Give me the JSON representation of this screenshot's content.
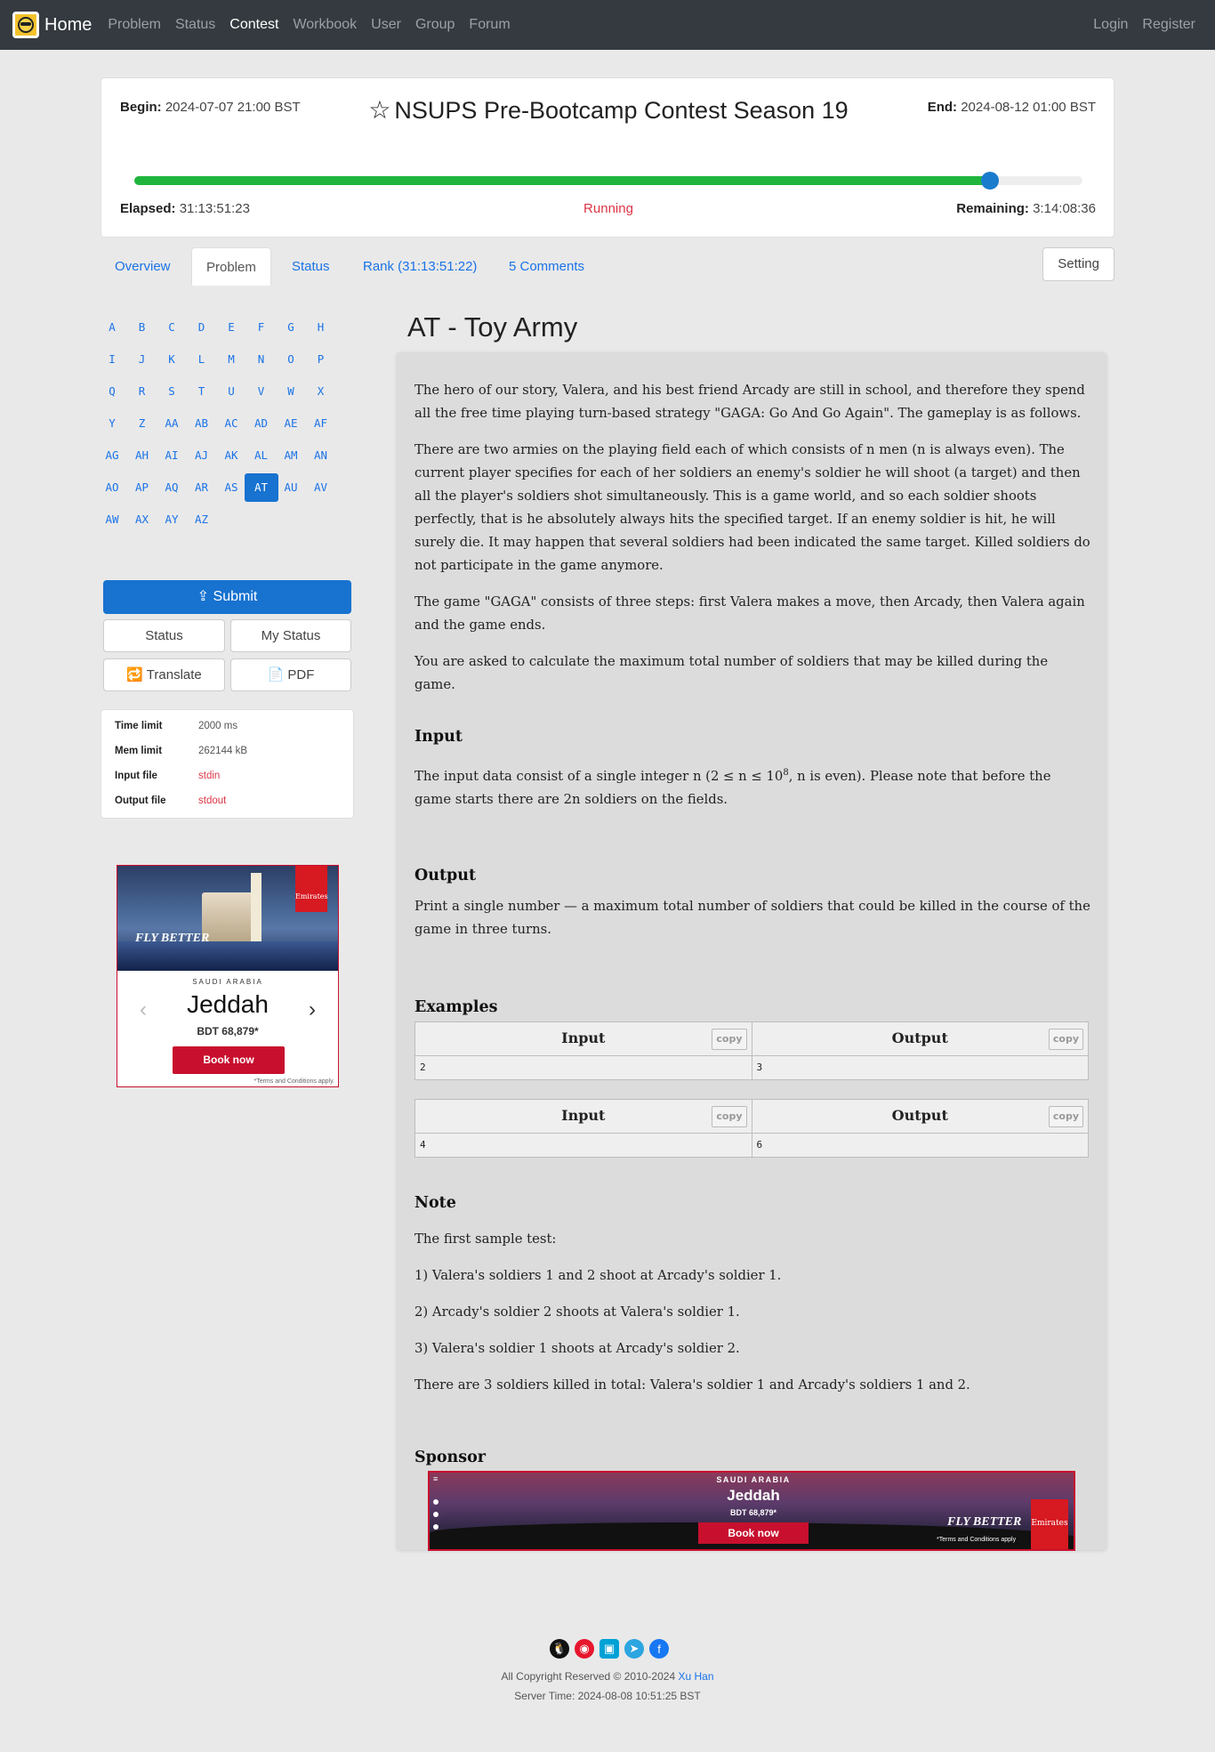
{
  "nav": {
    "brand": "Home",
    "items": [
      "Problem",
      "Status",
      "Contest",
      "Workbook",
      "User",
      "Group",
      "Forum"
    ],
    "active": "Contest",
    "login": "Login",
    "register": "Register"
  },
  "contest": {
    "begin_label": "Begin:",
    "begin": "2024-07-07 21:00 BST",
    "end_label": "End:",
    "end": "2024-08-12 01:00 BST",
    "title": "NSUPS Pre-Bootcamp Contest Season 19",
    "progress": 0.902,
    "elapsed_label": "Elapsed:",
    "elapsed": "31:13:51:23",
    "status": "Running",
    "remaining_label": "Remaining:",
    "remaining": "3:14:08:36"
  },
  "tabs": {
    "overview": "Overview",
    "problem": "Problem",
    "status": "Status",
    "rank": "Rank (31:13:51:22)",
    "comments": "5 Comments",
    "setting": "Setting"
  },
  "letters": [
    "A",
    "B",
    "C",
    "D",
    "E",
    "F",
    "G",
    "H",
    "I",
    "J",
    "K",
    "L",
    "M",
    "N",
    "O",
    "P",
    "Q",
    "R",
    "S",
    "T",
    "U",
    "V",
    "W",
    "X",
    "Y",
    "Z",
    "AA",
    "AB",
    "AC",
    "AD",
    "AE",
    "AF",
    "AG",
    "AH",
    "AI",
    "AJ",
    "AK",
    "AL",
    "AM",
    "AN",
    "AO",
    "AP",
    "AQ",
    "AR",
    "AS",
    "AT",
    "AU",
    "AV",
    "AW",
    "AX",
    "AY",
    "AZ"
  ],
  "active_letter": "AT",
  "actions": {
    "submit": "Submit",
    "status": "Status",
    "my_status": "My Status",
    "translate": "Translate",
    "pdf": "PDF"
  },
  "limits": {
    "time_label": "Time limit",
    "time": "2000 ms",
    "mem_label": "Mem limit",
    "mem": "262144 kB",
    "input_label": "Input file",
    "input": "stdin",
    "output_label": "Output file",
    "output": "stdout"
  },
  "ad": {
    "brand": "Emirates",
    "tagline": "FLY BETTER",
    "country": "SAUDI ARABIA",
    "city": "Jeddah",
    "price": "BDT 68,879*",
    "book": "Book now",
    "terms": "*Terms and Conditions apply."
  },
  "problem": {
    "title": "AT - Toy Army",
    "statement": [
      "The hero of our story, Valera, and his best friend Arcady are still in school, and therefore they spend all the free time playing turn-based strategy \"GAGA: Go And Go Again\". The gameplay is as follows.",
      "There are two armies on the playing field each of which consists of n men (n is always even). The current player specifies for each of her soldiers an enemy's soldier he will shoot (a target) and then all the player's soldiers shot simultaneously. This is a game world, and so each soldier shoots perfectly, that is he absolutely always hits the specified target. If an enemy soldier is hit, he will surely die. It may happen that several soldiers had been indicated the same target. Killed soldiers do not participate in the game anymore.",
      "The game \"GAGA\" consists of three steps: first Valera makes a move, then Arcady, then Valera again and the game ends.",
      "You are asked to calculate the maximum total number of soldiers that may be killed during the game."
    ],
    "input_title": "Input",
    "input_text_1": "The input data consist of a single integer n (2 ≤ n ≤ 10",
    "input_exp": "8",
    "input_text_2": ", n is even). Please note that before the game starts there are 2n soldiers on the fields.",
    "output_title": "Output",
    "output_text": "Print a single number — a maximum total number of soldiers that could be killed in the course of the game in three turns.",
    "examples_title": "Examples",
    "example_input_label": "Input",
    "example_output_label": "Output",
    "copy": "copy",
    "examples": [
      {
        "input": "2",
        "output": "3"
      },
      {
        "input": "4",
        "output": "6"
      }
    ],
    "note_title": "Note",
    "note": [
      "The first sample test:",
      "1) Valera's soldiers 1 and 2 shoot at Arcady's soldier 1.",
      "2) Arcady's soldier 2 shoots at Valera's soldier 1.",
      "3) Valera's soldier 1 shoots at Arcady's soldier 2.",
      "There are 3 soldiers killed in total: Valera's soldier 1 and Arcady's soldiers 1 and 2."
    ],
    "sponsor_title": "Sponsor"
  },
  "sponsor_ad": {
    "country": "SAUDI ARABIA",
    "city": "Jeddah",
    "price": "BDT 68,879*",
    "book": "Book now",
    "tagline": "FLY BETTER",
    "terms": "*Terms and Conditions apply",
    "brand": "Emirates"
  },
  "footer": {
    "copyright": "All Copyright Reserved © 2010-2024",
    "author": "Xu Han",
    "server_time": "Server Time: 2024-08-08 10:51:25 BST"
  },
  "colors": {
    "accent": "#1772d0",
    "progress": "#1fb53d",
    "danger": "#dc3545",
    "navbar": "#343a40"
  }
}
